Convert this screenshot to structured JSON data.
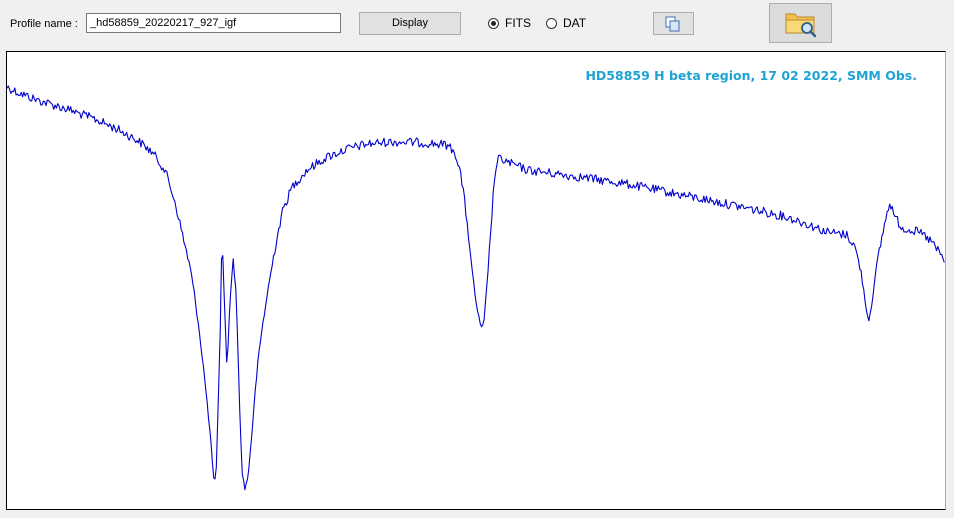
{
  "toolbar": {
    "profile_label": "Profile name :",
    "profile_value": "_hd58859_20220217_927_igf",
    "display_label": "Display",
    "radio_options": [
      {
        "label": "FITS",
        "checked": true
      },
      {
        "label": "DAT",
        "checked": false
      }
    ],
    "copy_icon": "copy-pages-icon",
    "open_icon": "folder-search-icon"
  },
  "plot": {
    "title": "HD58859 H beta region, 17 02 2022, SMM Obs.",
    "line_color": "#0000cc",
    "title_color": "#1fa3d4"
  }
}
